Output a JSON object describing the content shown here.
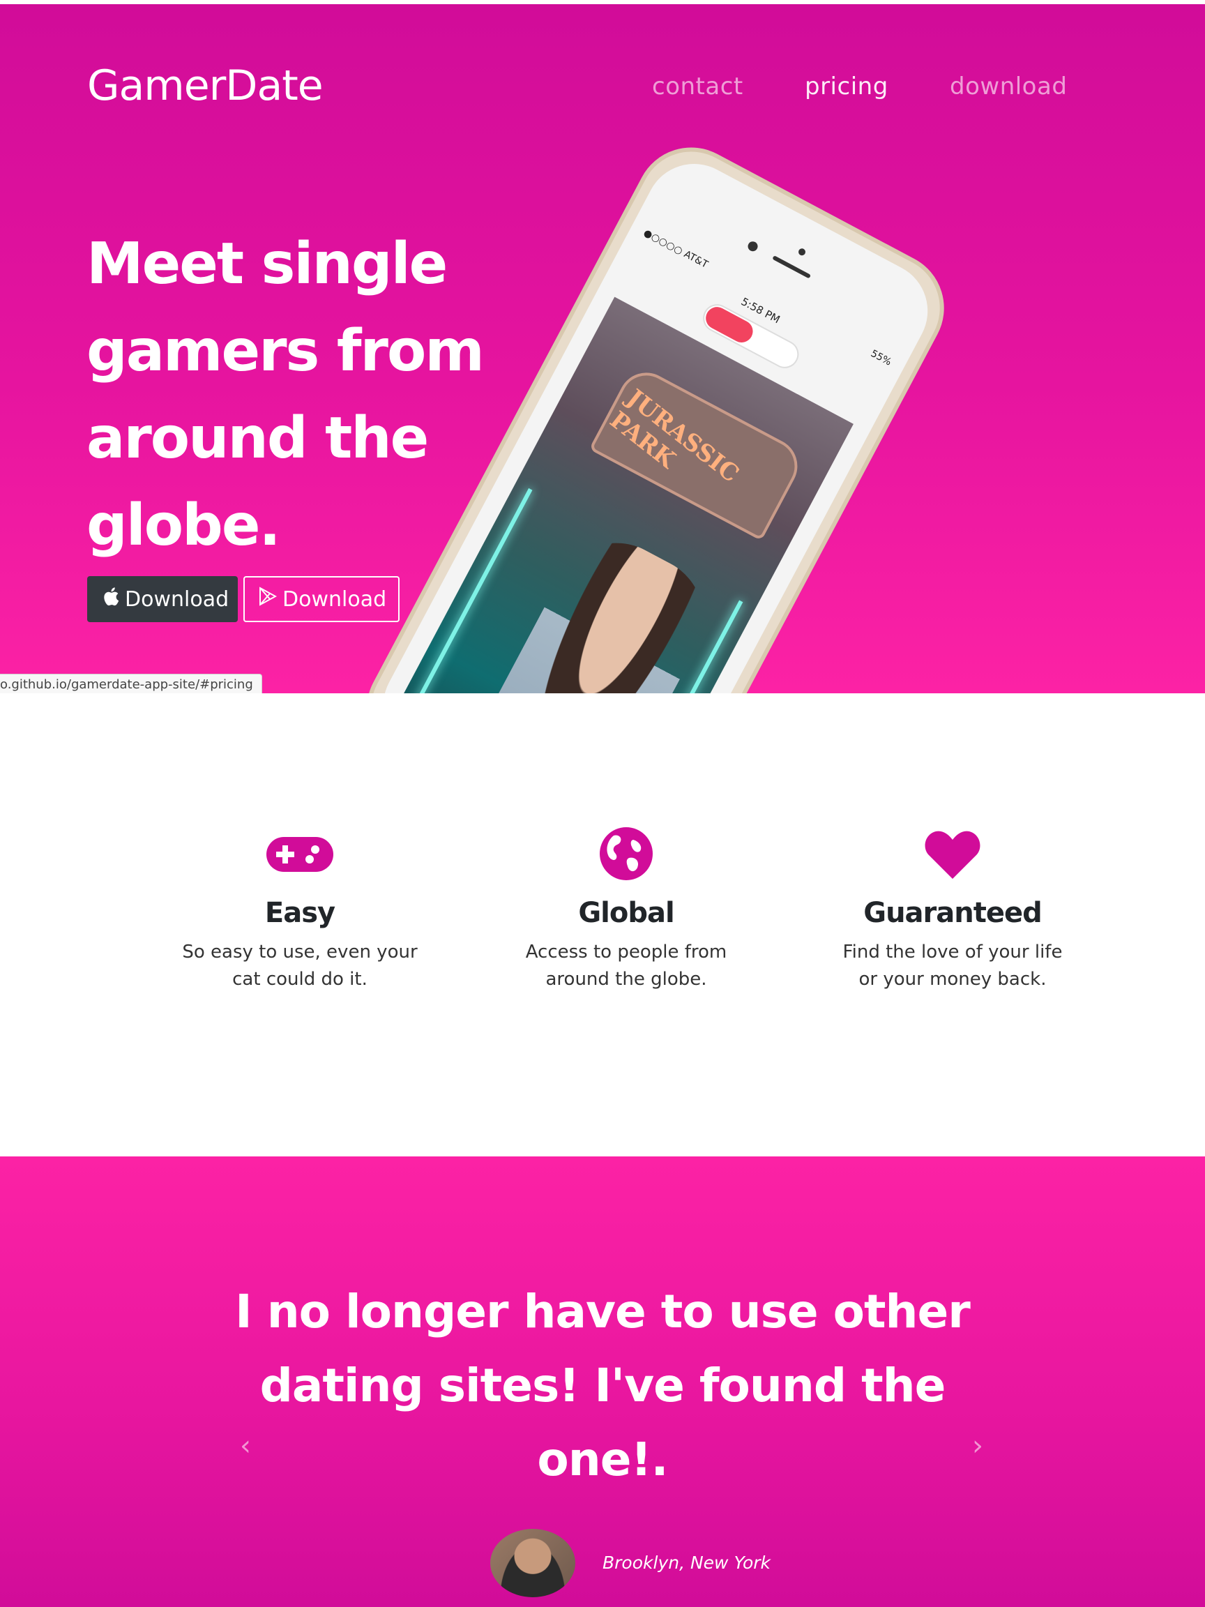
{
  "header": {
    "brand": "GamerDate",
    "nav": [
      {
        "label": "contact"
      },
      {
        "label": "pricing"
      },
      {
        "label": "download"
      }
    ]
  },
  "hero": {
    "headline_lines": [
      "Meet single",
      "gamers from",
      "around the",
      "globe."
    ],
    "buttons": [
      {
        "label": "Download",
        "icon": "apple-icon",
        "style": "dark"
      },
      {
        "label": "Download",
        "icon": "google-play-icon",
        "style": "outline"
      }
    ],
    "phone": {
      "carrier": "●○○○○ AT&T",
      "time": "5:58 PM",
      "battery": "55%",
      "sign_text": "JURASSIC PARK"
    }
  },
  "status_url": "o.github.io/gamerdate-app-site/#pricing",
  "features": [
    {
      "icon": "gamepad-icon",
      "title": "Easy",
      "lines": [
        "So easy to use, even your",
        "cat could do it."
      ]
    },
    {
      "icon": "globe-icon",
      "title": "Global",
      "lines": [
        "Access to people from",
        "around the globe."
      ]
    },
    {
      "icon": "heart-icon",
      "title": "Guaranteed",
      "lines": [
        "Find the love of your life",
        "or your money back."
      ]
    }
  ],
  "testimonial": {
    "quote_lines": [
      "I no longer have to use other",
      "dating sites! I've found the",
      "one!."
    ],
    "location": "Brooklyn, New York",
    "prev_arrow": "‹",
    "next_arrow": "›"
  },
  "colors": {
    "accent": "#d10c99",
    "accent_light": "#fc22a5",
    "dark_button": "#343a40",
    "heading_text": "#212529"
  }
}
